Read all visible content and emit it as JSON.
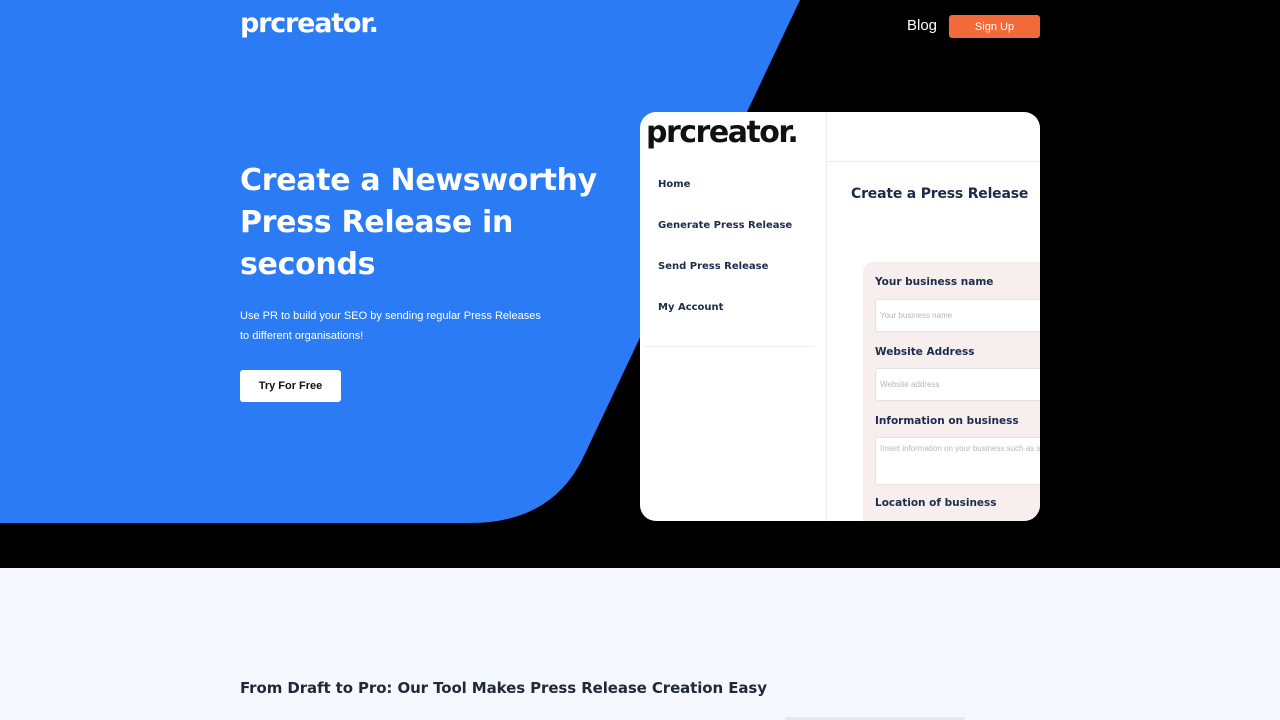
{
  "colors": {
    "blue": "#2a7bf4",
    "black": "#000000",
    "orange": "#f26a3a",
    "navy": "#1c2b4a",
    "form_bg": "#f7efee",
    "page_bg": "#f5f9fd"
  },
  "header": {
    "logo": "prcreator.",
    "blog": "Blog",
    "signup": "Sign Up"
  },
  "hero": {
    "title": "Create a Newsworthy Press Release in seconds",
    "subtitle": "Use PR to build your SEO by sending regular Press Releases to different organisations!",
    "cta": "Try For Free"
  },
  "mockup": {
    "logo": "prcreator.",
    "nav": [
      "Home",
      "Generate Press Release",
      "Send Press Release",
      "My Account"
    ],
    "title": "Create a Press Release",
    "fields": [
      {
        "label": "Your business name",
        "placeholder": "Your business name"
      },
      {
        "label": "Website Address",
        "placeholder": "Website address"
      },
      {
        "label": "Information on business",
        "placeholder": "Insert information on your business such as services"
      },
      {
        "label": "Location of business"
      }
    ]
  },
  "section2": {
    "title": "From Draft to Pro: Our Tool Makes Press Release Creation Easy"
  }
}
